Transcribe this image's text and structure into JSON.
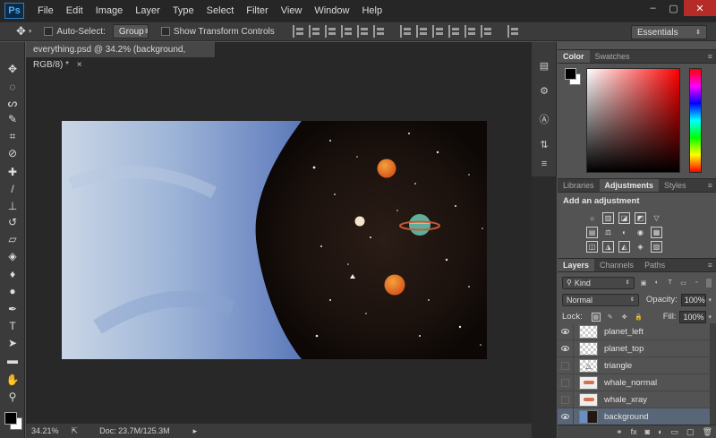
{
  "app": {
    "logo": "Ps"
  },
  "menu": [
    "File",
    "Edit",
    "Image",
    "Layer",
    "Type",
    "Select",
    "Filter",
    "View",
    "Window",
    "Help"
  ],
  "window_controls": {
    "minimize": "‒",
    "maximize": "▢",
    "close": "✕"
  },
  "options_bar": {
    "tool_glyph": "✥",
    "auto_select_label": "Auto-Select:",
    "auto_select_value": "Group",
    "show_transform_label": "Show Transform Controls",
    "workspace": "Essentials"
  },
  "document": {
    "tab_title": "everything.psd @ 34.2% (background, RGB/8) *",
    "tab_close": "×"
  },
  "status": {
    "zoom": "34.21%",
    "doc": "Doc: 23.7M/125.3M",
    "arrow": "▸"
  },
  "color_panel": {
    "tabs": [
      "Color",
      "Swatches"
    ]
  },
  "adjustments_panel": {
    "tabs": [
      "Libraries",
      "Adjustments",
      "Styles"
    ],
    "title": "Add an adjustment",
    "row1": [
      "☼",
      "▥",
      "◪",
      "◩",
      "▽"
    ],
    "row2": [
      "▤",
      "⚖",
      "◐",
      "◉",
      "▦"
    ],
    "row3": [
      "◫",
      "◮",
      "◭",
      "◈",
      "▧"
    ]
  },
  "layers_panel": {
    "tabs": [
      "Layers",
      "Channels",
      "Paths"
    ],
    "kind": "Kind",
    "blend_mode": "Normal",
    "opacity_label": "Opacity:",
    "opacity_value": "100%",
    "lock_label": "Lock:",
    "fill_label": "Fill:",
    "fill_value": "100%",
    "layers": [
      {
        "name": "planet_left",
        "visible": true,
        "thumb": "check"
      },
      {
        "name": "planet_top",
        "visible": true,
        "thumb": "check"
      },
      {
        "name": "triangle",
        "visible": false,
        "thumb": "triangle"
      },
      {
        "name": "whale_normal",
        "visible": false,
        "thumb": "whale"
      },
      {
        "name": "whale_xray",
        "visible": false,
        "thumb": "whale"
      },
      {
        "name": "background",
        "visible": true,
        "thumb": "bg",
        "selected": true
      }
    ]
  },
  "colors": {
    "fg": "#000000",
    "bg": "#ffffff",
    "selected_layer": "#596678",
    "ps_blue": "#4fb0f5"
  }
}
